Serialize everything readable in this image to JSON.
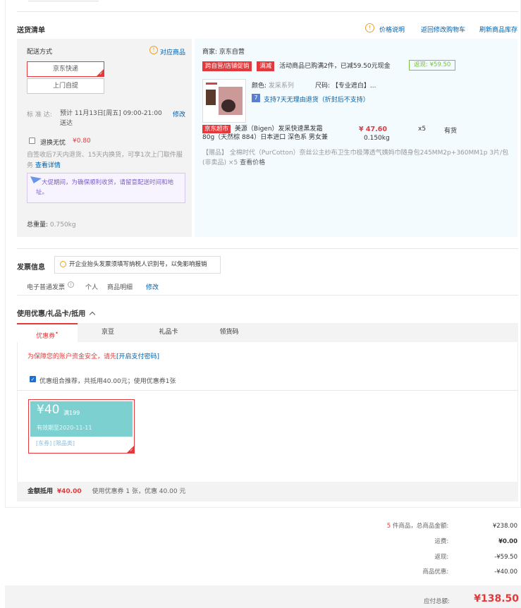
{
  "delivery": {
    "title": "送货清单",
    "price_desc": "价格说明",
    "back_cart": "返回修改购物车",
    "refresh_stock": "刷新商品库存",
    "ship_method_label": "配送方式",
    "match_goods": "对应商品",
    "options": [
      "京东快递",
      "上门自提"
    ],
    "standard_label": "标 准 达:",
    "standard_value": "预计 11月13日[周五] 09:00-21:00 送达",
    "modify": "修改",
    "worry_free": "退换无忧",
    "worry_free_price": "¥0.80",
    "worry_free_desc": "自签收后7天内退货、15天内换货，可享1次上门取件服务",
    "view_detail": "查看详情",
    "notice": "大促期间，为确保顺利收货，请留意配送时间和地址。",
    "weight_label": "总重量:",
    "weight_value": "0.750kg"
  },
  "merchant": {
    "label": "商家:",
    "name": "京东自营",
    "promo_tag": "跨自营/店铺促销",
    "promo_type": "满减",
    "promo_text": "活动商品已购满2件，已减59.50元现金",
    "return_label": "返现: ¥59.50",
    "color_label": "颜色:",
    "color_value": "发采系列",
    "size_label": "尺码:",
    "size_value": "【专业遮白】...",
    "return_policy": "支持7天无理由退货（折封后不支持）",
    "jd_tag": "京东超市",
    "product_name_1": "美源（Bigen）发采快速黑发霜",
    "product_name_2": "80g（天然棕 884）日本进口 深色系 男女兼",
    "price": "¥ 47.60",
    "qty": "x5",
    "stock": "有货",
    "weight": "0.150kg",
    "gift_tag": "【赠品】",
    "gift_text": "全棉时代（PurCotton）奈丝公主纱布卫生巾极薄透气姨妈巾随身包245MM2p+360MM1p 3片/包",
    "gift_text_2": "(非卖品)",
    "gift_qty": "×5",
    "view_price": "查看价格"
  },
  "invoice": {
    "title": "发票信息",
    "tooltip": "开企业抬头发票须填写纳税人识别号，以免影响报销",
    "type": "电子普通发票",
    "person": "个人",
    "detail": "商品明细",
    "modify": "修改"
  },
  "coupon_section": {
    "title": "使用优惠/礼品卡/抵用",
    "tabs": [
      "优惠券",
      "京豆",
      "礼品卡",
      "领货码"
    ],
    "security_text": "为保障您的账户资金安全，请先",
    "security_link": "[开启支付密码]",
    "combo_text": "优惠组合推荐，共抵用40.00元；使用优惠券1张",
    "coupon_amount": "¥40",
    "coupon_cond": "满199",
    "coupon_expiry": "有效期至2020-11-11",
    "coupon_tags": "[东券] [限品类]",
    "summary_label": "金额抵用",
    "summary_amount": "¥40.00",
    "summary_desc": "使用优惠券 1 张，优惠 40.00 元"
  },
  "totals": {
    "count": "5",
    "count_label": "件商品，总商品金额:",
    "goods_total": "¥238.00",
    "shipping_label": "运费:",
    "shipping": "¥0.00",
    "return_label": "返现:",
    "return_value": "-¥59.50",
    "discount_label": "商品优惠:",
    "discount_value": "-¥40.00",
    "payable_label": "应付总额:",
    "payable": "¥138.50"
  }
}
